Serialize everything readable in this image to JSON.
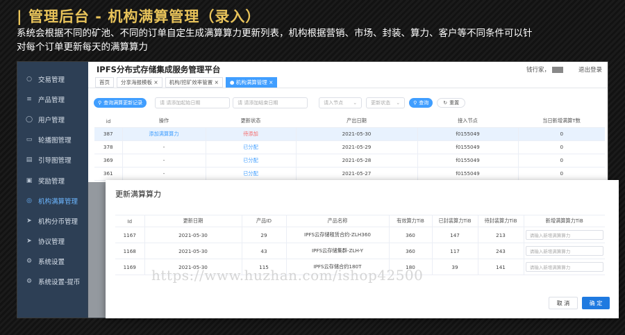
{
  "promo": {
    "headline": "| 管理后台 - 机构满算管理（录入）",
    "sub1": "系统会根据不同的矿池、不同的订单自定生成满算算力更新列表，机构根据营销、市场、封装、算力、客户等不同条件可以针",
    "sub2": "对每个订单更新每天的满算算力"
  },
  "app": {
    "title": "IPFS分布式存储集成服务管理平台",
    "user_label": "钱行家，",
    "logout": "退出登录"
  },
  "sidebar": {
    "items": [
      {
        "label": "交易管理",
        "icon": "○"
      },
      {
        "label": "产品管理",
        "icon": "≡"
      },
      {
        "label": "用户管理",
        "icon": "◯"
      },
      {
        "label": "轮播图管理",
        "icon": "▭"
      },
      {
        "label": "引导图管理",
        "icon": "▤"
      },
      {
        "label": "奖励管理",
        "icon": "▣"
      },
      {
        "label": "机构满算管理",
        "icon": "◎"
      },
      {
        "label": "机构分币管理",
        "icon": "➤"
      },
      {
        "label": "协议管理",
        "icon": "➤"
      },
      {
        "label": "系统设置",
        "icon": "⚙"
      },
      {
        "label": "系统设置-提币",
        "icon": "⚙"
      }
    ]
  },
  "tabs": [
    {
      "label": "首页"
    },
    {
      "label": "分享海报模板 ×"
    },
    {
      "label": "机构/挖矿效率管置 ×"
    },
    {
      "label": "● 机构满算管理 ×"
    }
  ],
  "filters": {
    "query_records": "查询满算更新记录",
    "start_date": "请 请添加起始日期",
    "end_date": "请 请添加结束日期",
    "node": "请入节点",
    "status": "更新状态",
    "search": "查询",
    "reset": "重置"
  },
  "main_table": {
    "headers": [
      "id",
      "操作",
      "更新状态",
      "产出日期",
      "接入节点",
      "当日新增满算T数"
    ],
    "rows": [
      {
        "id": "387",
        "op": "添加满算算力",
        "status": "待添加",
        "date": "2021-05-30",
        "node": "f0155049",
        "count": "0"
      },
      {
        "id": "378",
        "op": "-",
        "status": "已分配",
        "date": "2021-05-29",
        "node": "f0155049",
        "count": "0"
      },
      {
        "id": "369",
        "op": "-",
        "status": "已分配",
        "date": "2021-05-28",
        "node": "f0155049",
        "count": "0"
      },
      {
        "id": "361",
        "op": "-",
        "status": "已分配",
        "date": "2021-05-27",
        "node": "f0155049",
        "count": "0"
      }
    ]
  },
  "dialog": {
    "title": "更新满算算力",
    "headers": [
      "Id",
      "更新日期",
      "产品ID",
      "产品名称",
      "有效算力TiB",
      "已封装算力TiB",
      "待封装算力TiB",
      "新增满算算力TiB"
    ],
    "input_placeholder": "请输入新增满算算力",
    "rows": [
      {
        "id": "1167",
        "date": "2021-05-30",
        "pid": "29",
        "name": "IPFS云存储租赁合约-ZLH360",
        "valid": "360",
        "sealed": "147",
        "pending": "213"
      },
      {
        "id": "1168",
        "date": "2021-05-30",
        "pid": "43",
        "name": "IPFS云存储集群-ZLH-Y",
        "valid": "360",
        "sealed": "117",
        "pending": "243"
      },
      {
        "id": "1169",
        "date": "2021-05-30",
        "pid": "115",
        "name": "IPFS云存储合约180T",
        "valid": "180",
        "sealed": "39",
        "pending": "141"
      }
    ],
    "cancel": "取 消",
    "ok": "确 定"
  },
  "watermark": "https://www.huzhan.com/ishop42500"
}
